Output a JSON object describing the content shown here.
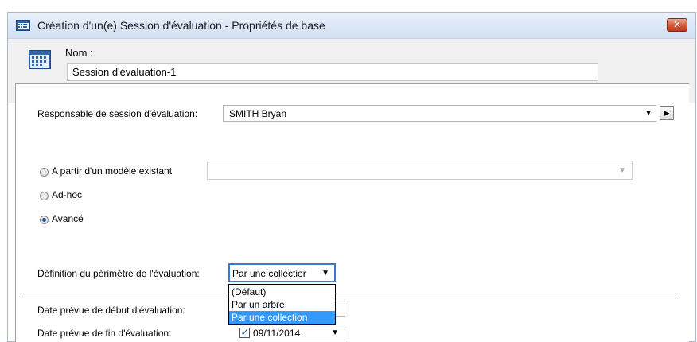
{
  "window": {
    "title": "Création d'un(e) Session d'évaluation - Propriétés de base",
    "close_label": "✕"
  },
  "name": {
    "label": "Nom :",
    "value": "Session d'évaluation-1"
  },
  "responsable": {
    "label": "Responsable de session d'évaluation:",
    "value": "SMITH Bryan"
  },
  "options": {
    "from_model": "A partir d'un modèle existant",
    "ad_hoc": "Ad-hoc",
    "advanced": "Avancé",
    "selected": "advanced"
  },
  "scope": {
    "label": "Définition du périmètre de l'évaluation:",
    "value": "Par une collectior",
    "dropdown_options": [
      "(Défaut)",
      "Par un arbre",
      "Par une collection"
    ],
    "highlighted": "Par une collection"
  },
  "dates": {
    "start_label": "Date prévue de début d'évaluation:",
    "end_label": "Date prévue de fin d'évaluation:",
    "end_value": "09/11/2014",
    "end_checked": true
  },
  "icons": {
    "window": "calendar-icon",
    "name": "calendar-icon"
  },
  "colors": {
    "titlebar": "#dbe7f6",
    "close_button": "#d45c3c",
    "highlight": "#3399ff"
  }
}
